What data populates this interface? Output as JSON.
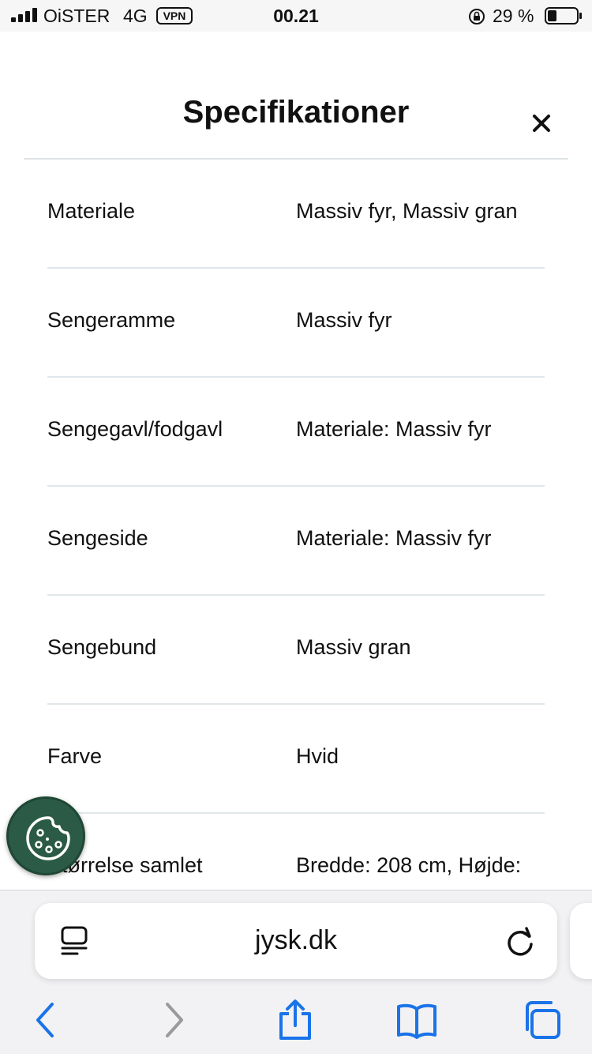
{
  "status_bar": {
    "carrier": "OiSTER",
    "network": "4G",
    "vpn": "VPN",
    "time": "00.21",
    "battery": "29 %"
  },
  "modal": {
    "title": "Specifikationer",
    "close_icon": "close-icon"
  },
  "specs": [
    {
      "label": "Materiale",
      "value": "Massiv fyr, Massiv gran"
    },
    {
      "label": "Sengeramme",
      "value": "Massiv fyr"
    },
    {
      "label": "Sengegavl/fodgavl",
      "value": "Materiale: Massiv fyr"
    },
    {
      "label": "Sengeside",
      "value": "Materiale: Massiv fyr"
    },
    {
      "label": "Sengebund",
      "value": "Massiv gran"
    },
    {
      "label": "Farve",
      "value": "Hvid"
    },
    {
      "label": "Størrelse samlet",
      "value": "Bredde: 208 cm, Højde:"
    }
  ],
  "browser": {
    "url": "jysk.dk",
    "icons": [
      "reader-icon",
      "reload-icon",
      "back-icon",
      "forward-icon",
      "share-icon",
      "bookmarks-icon",
      "tabs-icon"
    ],
    "accent": "#1a73e8"
  },
  "cookie": {
    "icon": "cookie-icon",
    "color": "#2b5a46"
  }
}
